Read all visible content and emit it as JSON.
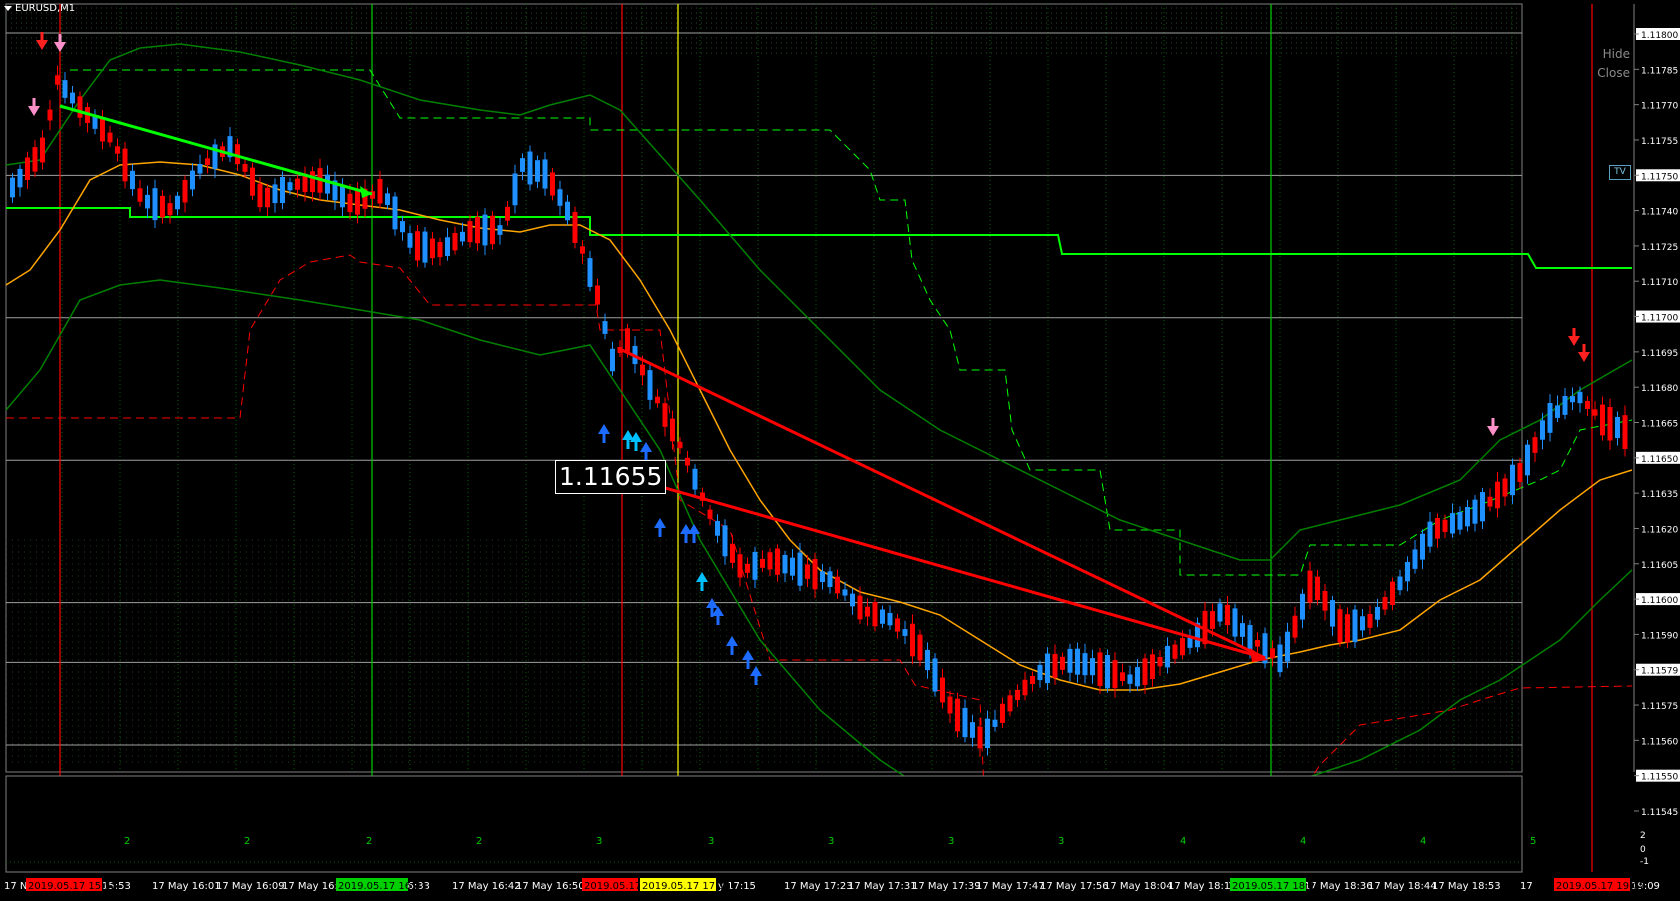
{
  "chart": {
    "symbol": "EURUSD,M1",
    "hide_label": "Hide",
    "close_label": "Close",
    "tv_badge": "TV",
    "crosshair_price": "1.11655"
  },
  "colors": {
    "background": "#000000",
    "bull_candle": "#1e90ff",
    "bear_candle": "#ff0000",
    "ma_line": "#ffa500",
    "bands": "#008000",
    "green_level": "#00ff00",
    "red_level": "#ff0000",
    "axis_text": "#ffffff"
  },
  "price_axis": {
    "labels": [
      "1.11800",
      "1.11785",
      "1.11770",
      "1.11755",
      "1.11750",
      "1.11740",
      "1.11725",
      "1.11710",
      "1.11700",
      "1.11695",
      "1.11680",
      "1.11665",
      "1.11650",
      "1.11635",
      "1.11620",
      "1.11605",
      "1.11600",
      "1.11590",
      "1.11579",
      "1.11575",
      "1.11560",
      "1.11550",
      "1.11545"
    ],
    "highlighted": [
      "1.11800",
      "1.11750",
      "1.11700",
      "1.11650",
      "1.11600",
      "1.11579",
      "1.11550"
    ]
  },
  "sub_window": {
    "counts": [
      "2",
      "2",
      "2",
      "2",
      "3",
      "3",
      "3",
      "3",
      "3",
      "4",
      "4",
      "4",
      "5"
    ],
    "axis": [
      "2",
      "0",
      "-1"
    ]
  },
  "time_axis": {
    "labels": [
      "17 N",
      "15:53",
      "17 May 16:01",
      "17 May 16:09",
      "17 May 16:17",
      "y 16:33",
      "17 May 16:42",
      "17 May 16:50",
      "y 17:15",
      "17 May 17:23",
      "17 May 17:31",
      "17 May 17:39",
      "17 May 17:47",
      "17 May 17:56",
      "17 May 18:04",
      "17 May 18:12",
      "17",
      "y 18:28",
      "17 May 18:36",
      "17 May 18:44",
      "17 May 18:53",
      "17",
      "y 19:09"
    ],
    "markers": [
      {
        "text": "2019.05.17 15:52",
        "color": "red"
      },
      {
        "text": "2019.05.17 16:31",
        "color": "green"
      },
      {
        "text": "2019.05.17",
        "color": "red"
      },
      {
        "text": "2019.05.17 17:11",
        "color": "yellow"
      },
      {
        "text": "2019.05.17 18:26",
        "color": "green"
      },
      {
        "text": "2019.05.17 19:07",
        "color": "red"
      }
    ]
  }
}
